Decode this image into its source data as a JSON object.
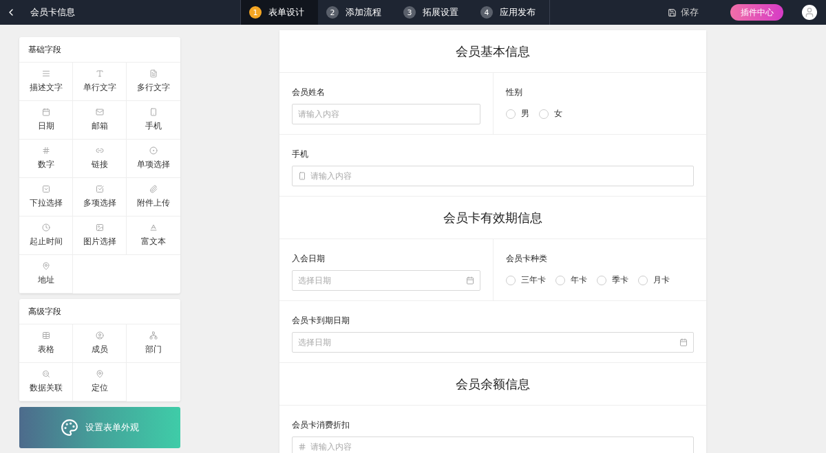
{
  "topbar": {
    "title": "会员卡信息",
    "save": "保存",
    "plugin_button": "插件中心",
    "steps": [
      {
        "number": "1",
        "label": "表单设计",
        "selected": true
      },
      {
        "number": "2",
        "label": "添加流程",
        "selected": false
      },
      {
        "number": "3",
        "label": "拓展设置",
        "selected": false
      },
      {
        "number": "4",
        "label": "应用发布",
        "selected": false
      }
    ]
  },
  "palette": [
    {
      "title": "基础字段",
      "items": [
        "描述文字",
        "单行文字",
        "多行文字",
        "日期",
        "邮箱",
        "手机",
        "数字",
        "链接",
        "单项选择",
        "下拉选择",
        "多项选择",
        "附件上传",
        "起止时间",
        "图片选择",
        "富文本",
        "地址"
      ]
    },
    {
      "title": "高级字段",
      "items": [
        "表格",
        "成员",
        "部门",
        "数据关联",
        "定位"
      ]
    }
  ],
  "appearance_banner": "设置表单外观",
  "form": {
    "sections": [
      {
        "title": "会员基本信息",
        "rows": [
          {
            "fields": [
              {
                "kind": "text",
                "label": "会员姓名",
                "placeholder": "请输入内容"
              },
              {
                "kind": "radio",
                "label": "性别",
                "options": [
                  {
                    "label": "男",
                    "selected": false
                  },
                  {
                    "label": "女",
                    "selected": false
                  }
                ]
              }
            ]
          },
          {
            "fields": [
              {
                "kind": "phone",
                "label": "手机",
                "placeholder": "请输入内容"
              }
            ]
          }
        ]
      },
      {
        "title": "会员卡有效期信息",
        "rows": [
          {
            "fields": [
              {
                "kind": "date",
                "label": "入会日期",
                "placeholder": "选择日期"
              },
              {
                "kind": "radio",
                "label": "会员卡种类",
                "options": [
                  {
                    "label": "三年卡",
                    "selected": false
                  },
                  {
                    "label": "年卡",
                    "selected": false
                  },
                  {
                    "label": "季卡",
                    "selected": false
                  },
                  {
                    "label": "月卡",
                    "selected": false
                  }
                ]
              }
            ]
          },
          {
            "fields": [
              {
                "kind": "date",
                "label": "会员卡到期日期",
                "placeholder": "选择日期"
              }
            ]
          }
        ]
      },
      {
        "title": "会员余额信息",
        "rows": [
          {
            "fields": [
              {
                "kind": "number",
                "label": "会员卡消费折扣",
                "placeholder": "请输入内容"
              }
            ]
          }
        ]
      }
    ]
  }
}
